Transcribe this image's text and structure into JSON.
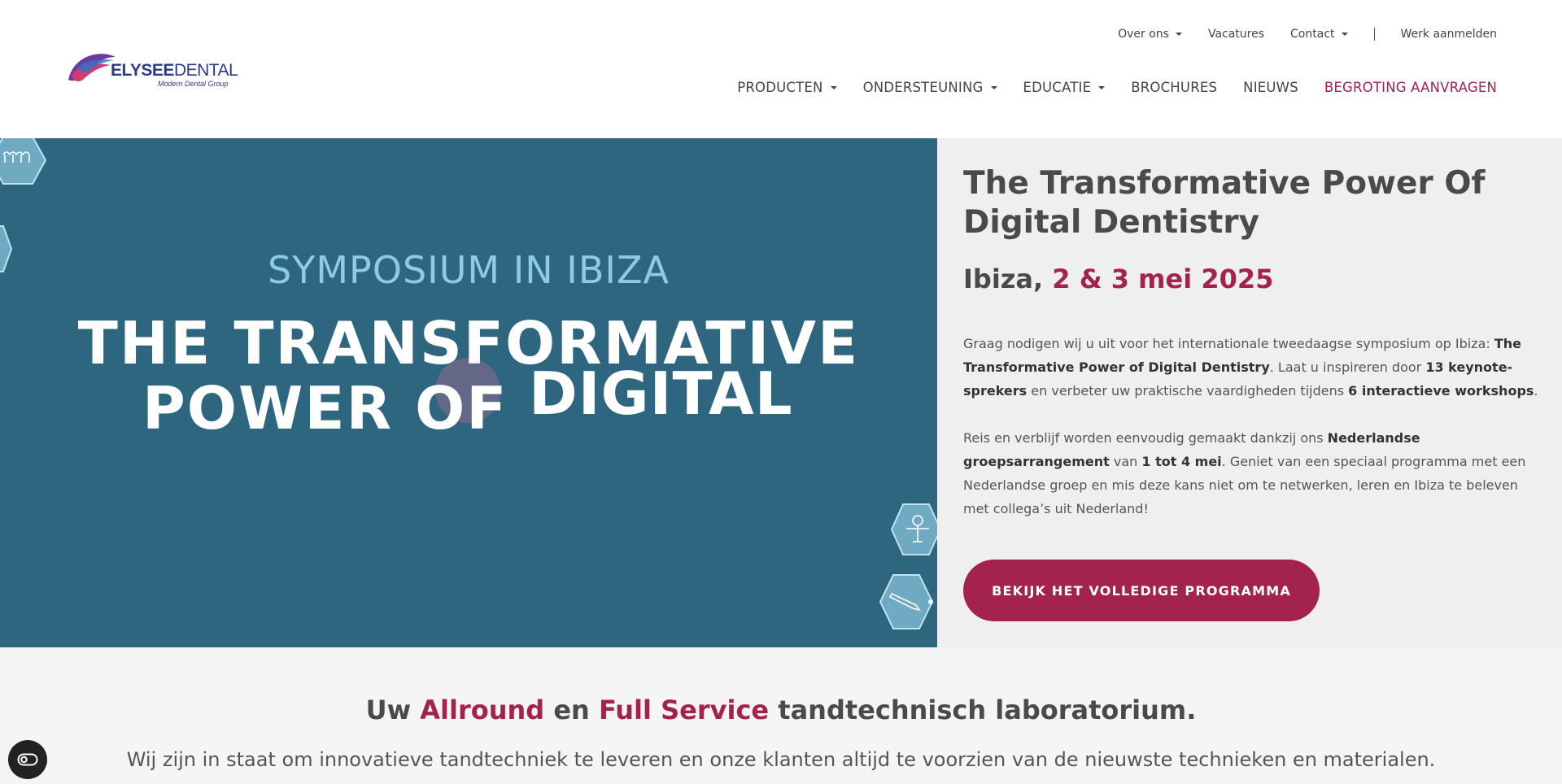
{
  "logo": {
    "brand_bold": "ELYSEE",
    "brand_light": "DENTAL",
    "tagline": "Modern Dental Group"
  },
  "topnav": [
    {
      "label": "Over ons",
      "dropdown": true
    },
    {
      "label": "Vacatures",
      "dropdown": false
    },
    {
      "label": "Contact",
      "dropdown": true
    },
    {
      "label": "Werk aanmelden",
      "dropdown": false
    }
  ],
  "mainnav": [
    {
      "label": "PRODUCTEN",
      "dropdown": true
    },
    {
      "label": "ONDERSTEUNING",
      "dropdown": true
    },
    {
      "label": "EDUCATIE",
      "dropdown": true
    },
    {
      "label": "BROCHURES",
      "dropdown": false
    },
    {
      "label": "NIEUWS",
      "dropdown": false
    },
    {
      "label": "BEGROTING AANVRAGEN",
      "dropdown": false
    }
  ],
  "hero": {
    "kicker": "SYMPOSIUM IN IBIZA",
    "title_line1": "THE TRANSFORMATIVE",
    "title_line2a": "POWER OF",
    "title_line2b": "DIGITAL"
  },
  "event": {
    "title": "The Transformative Power Of Digital Dentistry",
    "place": "Ibiza,",
    "dates": "2 & 3 mei 2025",
    "p1": {
      "t1": "Graag nodigen wij u uit voor het internationale tweedaagse symposium op Ibiza: ",
      "b1": "The Transformative Power of Digital Dentistry",
      "t2": ". Laat u inspireren door ",
      "b2": "13 keynote-sprekers",
      "t3": " en verbeter uw praktische vaardigheden tijdens ",
      "b3": "6 interactieve workshops",
      "t4": "."
    },
    "p2": {
      "t1": "Reis en verblijf worden eenvoudig gemaakt dankzij ons ",
      "b1": "Nederlandse groepsarrangement",
      "t2": " van ",
      "b2": "1 tot 4 mei",
      "t3": ". Geniet van een speciaal programma met een Nederlandse groep en mis deze kans niet om te netwerken, leren en Ibiza te beleven met collega’s uit Nederland!"
    },
    "cta": "BEKIJK HET VOLLEDIGE PROGRAMMA"
  },
  "intro": {
    "h_t1": "Uw ",
    "h_a1": "Allround",
    "h_t2": " en ",
    "h_a2": "Full Service",
    "h_t3": " tandtechnisch laboratorium.",
    "text": "Wij zijn in staat om innovatieve tandtechniek te leveren en onze klanten altijd te voorzien van de nieuwste technieken en materialen."
  },
  "colors": {
    "accent": "#a3234e",
    "hero_blue": "#2e6680",
    "hero_light": "#8ecbe0",
    "brand": "#2d3a87"
  },
  "icons": {
    "cookie": "cookie-settings-icon"
  }
}
